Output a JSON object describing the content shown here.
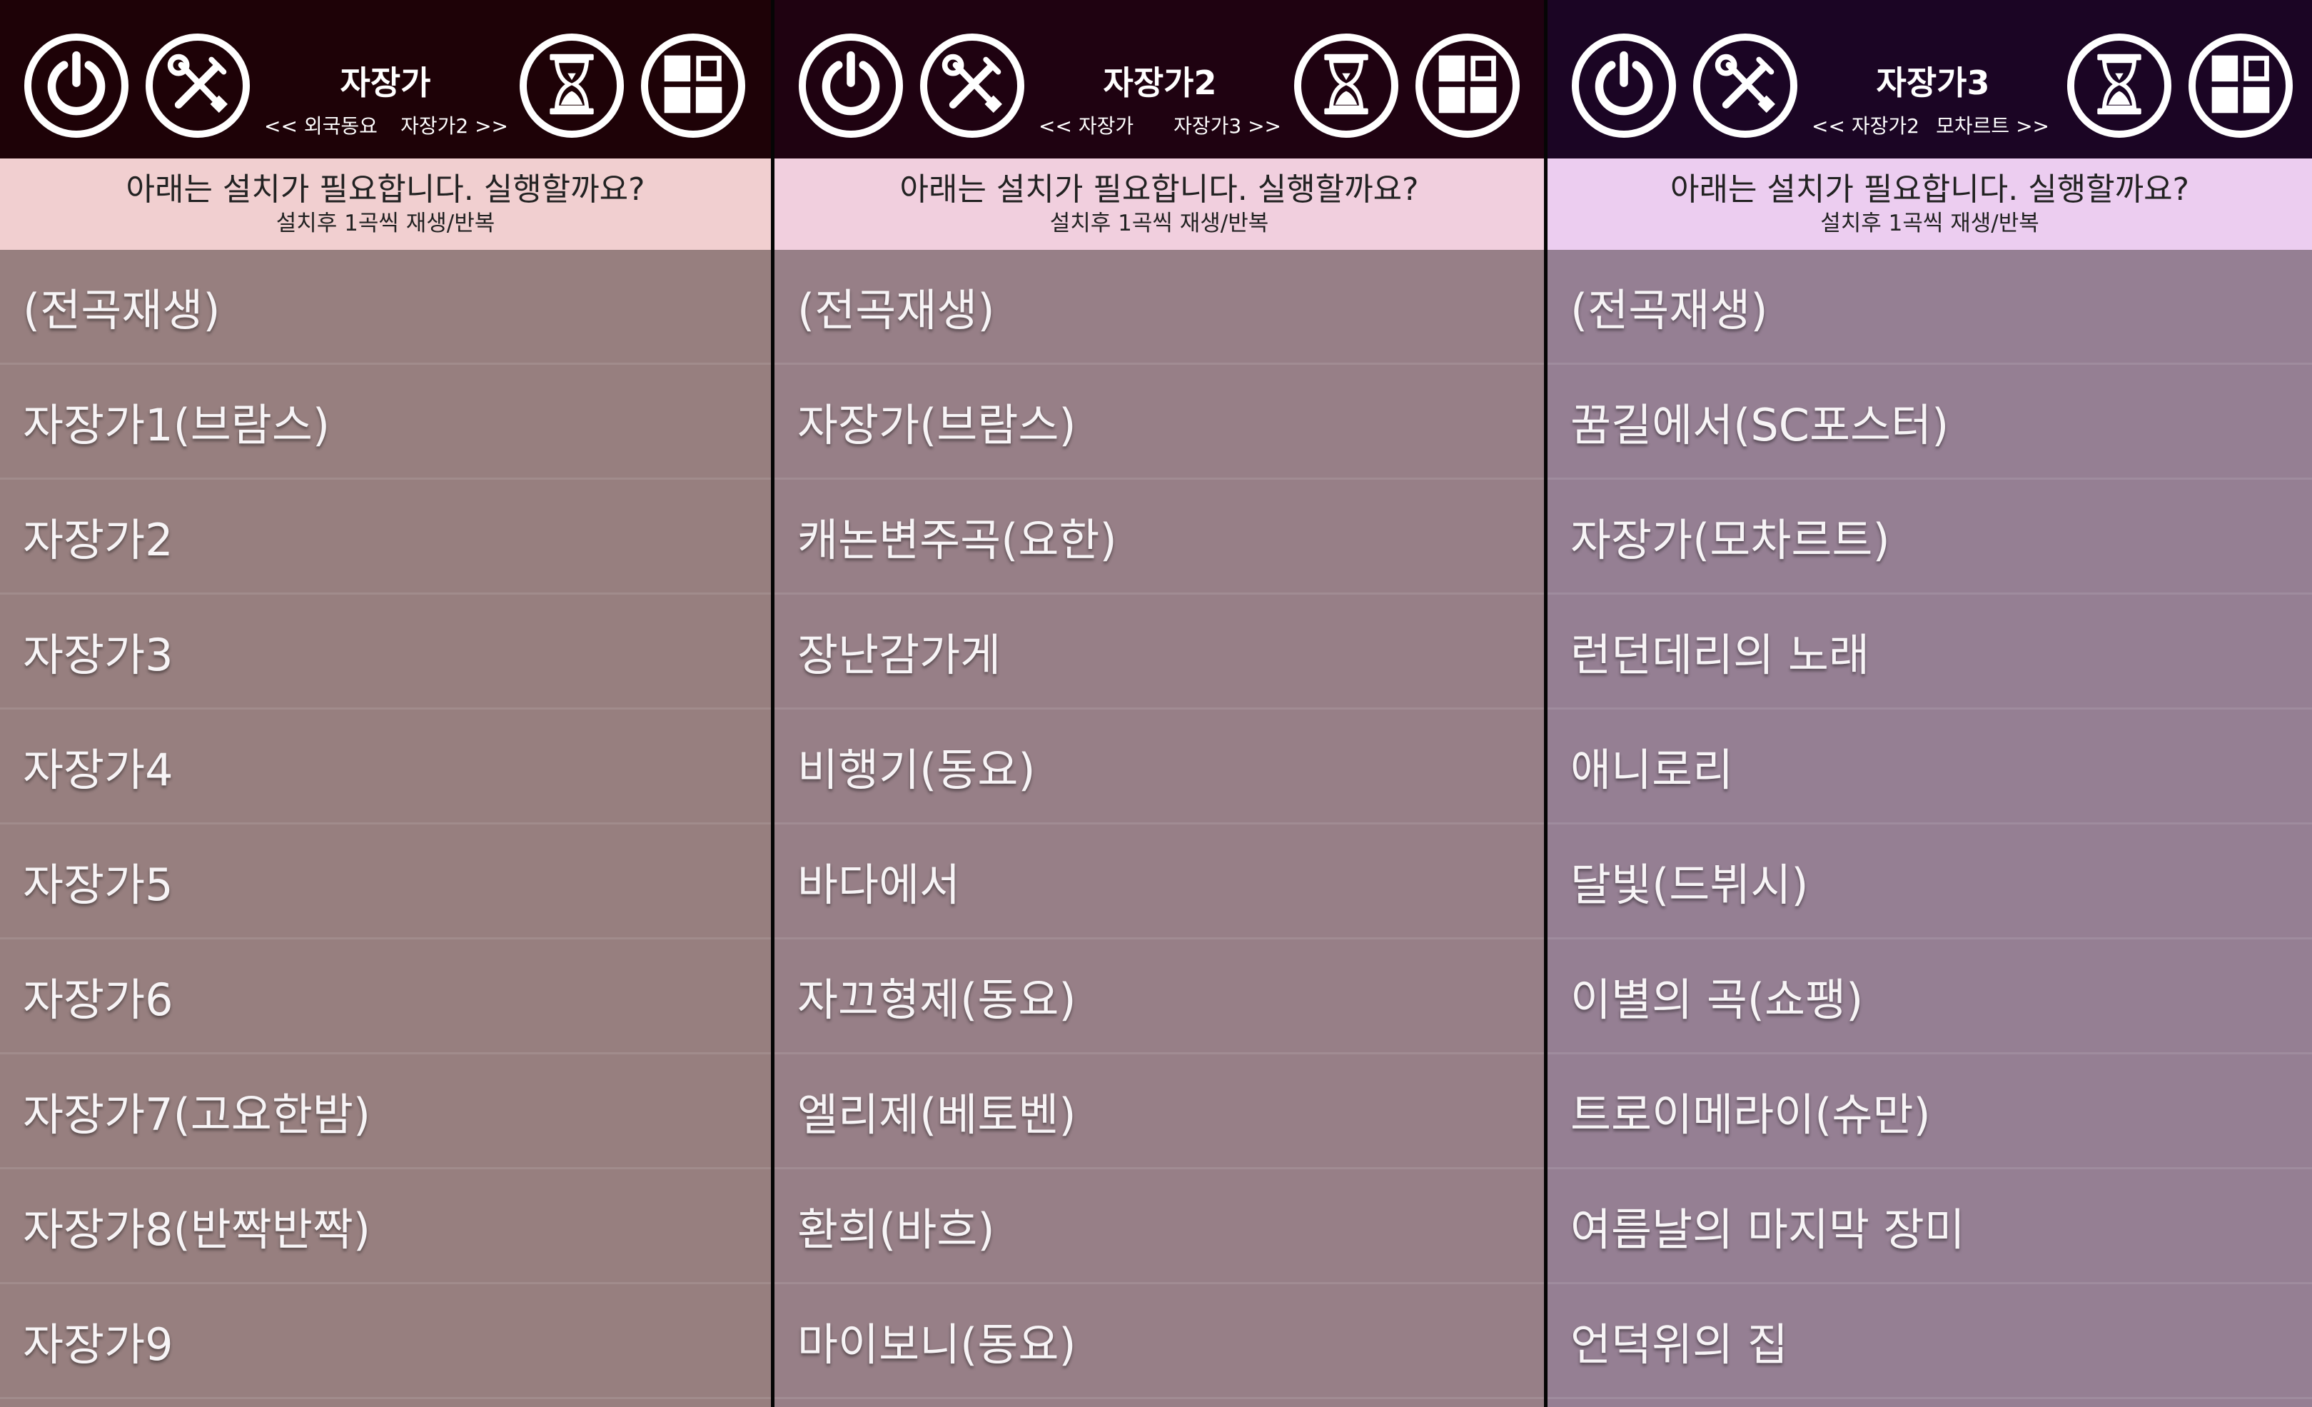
{
  "colors": {
    "header_bg": [
      "#1e0207",
      "#1f0211",
      "#1b0524"
    ],
    "notice_bg": [
      "#f1cfd0",
      "#f1cfde",
      "#eccdf0"
    ],
    "list_bg": [
      "#977f7f",
      "#977f87",
      "#957f93"
    ]
  },
  "panels": [
    {
      "icons": [
        "power-icon",
        "tools-icon",
        "hourglass-icon",
        "grid-icon"
      ],
      "title": "자장가",
      "nav_prev": "<< 외국동요",
      "nav_next": "자장가2 >>",
      "notice_main": "아래는 설치가 필요합니다. 실행할까요?",
      "notice_sub": "설치후 1곡씩 재생/반복",
      "items": [
        "(전곡재생)",
        "자장가1(브람스)",
        "자장가2",
        "자장가3",
        "자장가4",
        "자장가5",
        "자장가6",
        "자장가7(고요한밤)",
        "자장가8(반짝반짝)",
        "자장가9"
      ]
    },
    {
      "icons": [
        "power-icon",
        "tools-icon",
        "hourglass-icon",
        "grid-icon"
      ],
      "title": "자장가2",
      "nav_prev": "<< 자장가",
      "nav_next": "자장가3 >>",
      "notice_main": "아래는 설치가 필요합니다. 실행할까요?",
      "notice_sub": "설치후 1곡씩 재생/반복",
      "items": [
        "(전곡재생)",
        "자장가(브람스)",
        "캐논변주곡(요한)",
        "장난감가게",
        "비행기(동요)",
        "바다에서",
        "자끄형제(동요)",
        "엘리제(베토벤)",
        "환희(바흐)",
        "마이보니(동요)"
      ]
    },
    {
      "icons": [
        "power-icon",
        "tools-icon",
        "hourglass-icon",
        "grid-icon"
      ],
      "title": "자장가3",
      "nav_prev": "<< 자장가2",
      "nav_next": "모차르트 >>",
      "notice_main": "아래는 설치가 필요합니다. 실행할까요?",
      "notice_sub": "설치후 1곡씩 재생/반복",
      "items": [
        "(전곡재생)",
        "꿈길에서(SC포스터)",
        "자장가(모차르트)",
        "런던데리의 노래",
        "애니로리",
        "달빛(드뷔시)",
        "이별의 곡(쇼팽)",
        "트로이메라이(슈만)",
        "여름날의 마지막 장미",
        "언덕위의 집"
      ]
    }
  ]
}
